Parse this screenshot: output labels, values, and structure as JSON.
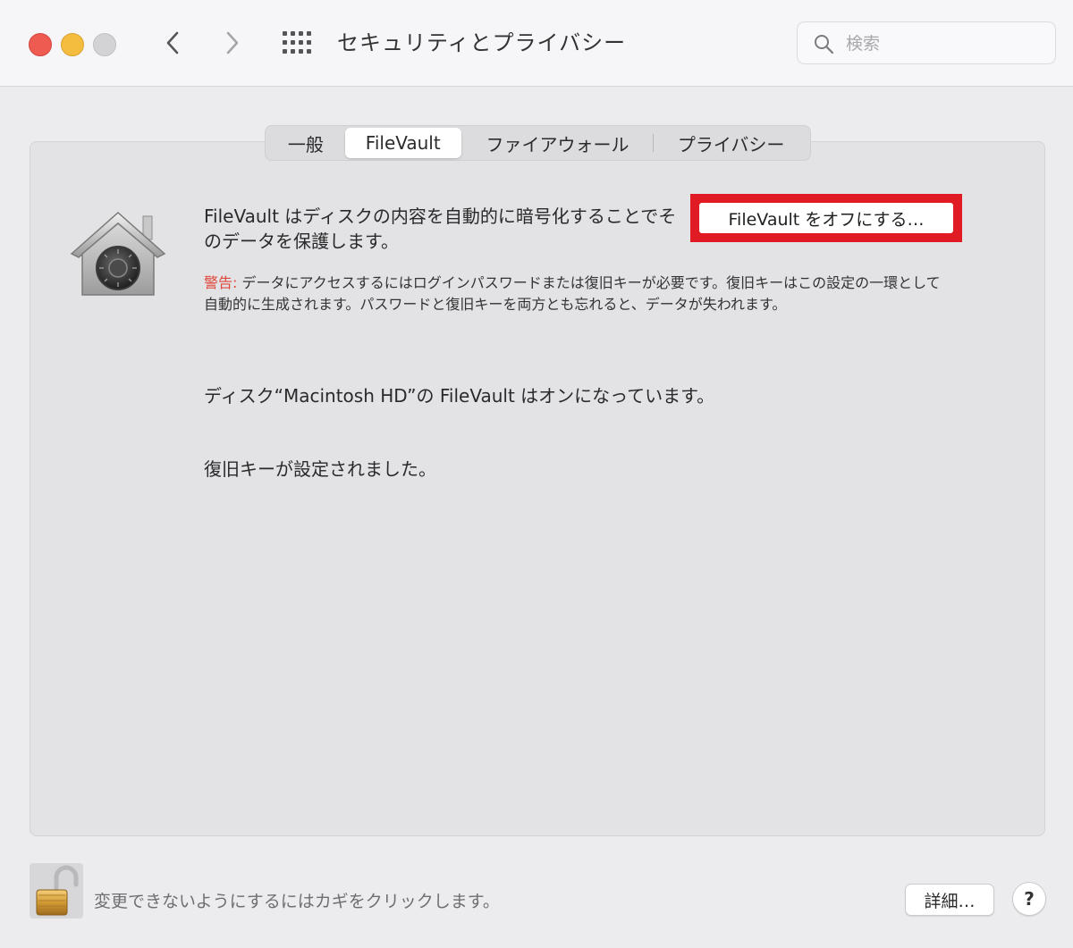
{
  "window": {
    "title": "セキュリティとプライバシー",
    "search_placeholder": "検索"
  },
  "icons": {
    "back": "chevron-left-icon",
    "forward": "chevron-right-icon",
    "grid": "grid-icon",
    "search": "magnifier-icon",
    "filevault": "filevault-house-icon",
    "lock": "unlocked-padlock-icon"
  },
  "tabs": [
    {
      "label": "一般",
      "selected": false
    },
    {
      "label": "FileVault",
      "selected": true
    },
    {
      "label": "ファイアウォール",
      "selected": false
    },
    {
      "label": "プライバシー",
      "selected": false
    }
  ],
  "filevault": {
    "description": "FileVault はディスクの内容を自動的に暗号化することでそのデータを保護します。",
    "turn_off_button": "FileVault をオフにする…",
    "warning_label": "警告:",
    "warning_text": " データにアクセスするにはログインパスワードまたは復旧キーが必要です。復旧キーはこの設定の一環として自動的に生成されます。パスワードと復旧キーを両方とも忘れると、データが失われます。",
    "status_disk": "ディスク“Macintosh HD”の FileVault はオンになっています。",
    "status_recovery": "復旧キーが設定されました。"
  },
  "footer": {
    "lock_text": "変更できないようにするにはカギをクリックします。",
    "details_button": "詳細…",
    "help_button": "?"
  },
  "colors": {
    "highlight_box": "#e01b24",
    "warning_label": "#e0473a",
    "close": "#ee5b51",
    "minimize": "#f4bd3f"
  }
}
